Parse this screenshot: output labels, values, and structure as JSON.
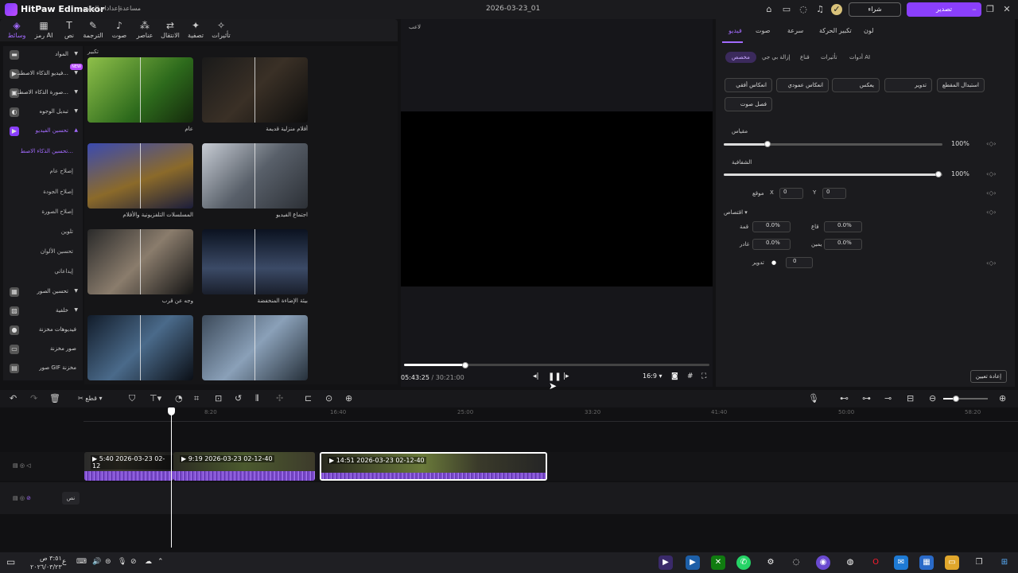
{
  "app": {
    "name": "HitPaw Edimakor",
    "project": "2026-03-23_01",
    "menu": [
      "مساعدة",
      "إعدادات",
      "الملف"
    ],
    "buy": "شراء",
    "export": "تصدير"
  },
  "media_tabs": [
    "وسائط",
    "رمز AI",
    "نص",
    "الترجمة",
    "صوت",
    "عناصر",
    "الانتقال",
    "تصفية",
    "تأثيرات"
  ],
  "left_nav": {
    "items": [
      "المواد",
      "فيديو الذكاء الاصطنـ...",
      "صورة الذكاء الاصطـ...",
      "تبديل الوجوه",
      "تحسين الفيديو"
    ],
    "new_badge": "NEW",
    "sub": [
      "تحسين الذكاء الاصط...",
      "إصلاح عام",
      "إصلاح الجودة",
      "إصلاح الصورة",
      "تلوين",
      "تحسين الألوان",
      "إيداعاتي"
    ],
    "items2": [
      "تحسين الصور",
      "خلفية",
      "فيديوهات مخزنة",
      "صور مخزنة",
      "صور GIF مخزنة"
    ]
  },
  "grid": {
    "heading": "تكبير",
    "captions": [
      "عام",
      "أفلام منزلية قديمة",
      "المسلسلات التلفزيونية والأفلام",
      "اجتماع الفيديو",
      "وجه عن قرب",
      "بيئة الإضاءة المنخفضة"
    ]
  },
  "player": {
    "label": "لاعب",
    "time_current": "05:43:25",
    "time_total": "/ 30:21:00",
    "ratio": "16:9",
    "progress": 0.2
  },
  "props": {
    "tabs": [
      "فيديو",
      "صوت",
      "سرعة",
      "تكبير الحركة",
      "لون"
    ],
    "subtabs": [
      "مخصص",
      "إزالة بي جي",
      "قناع",
      "تأثيرات",
      "أدوات AI"
    ],
    "buttons": [
      "استبدال المقطع",
      "تدوير",
      "يعكس",
      "انعكاس عمودي",
      "انعكاس أفقي",
      "فصل صوت"
    ],
    "scale_label": "مقياس",
    "scale_val": "100%",
    "opacity_label": "الشفافية",
    "opacity_val": "100%",
    "pos_label": "موقع",
    "x": "X",
    "x_val": "0",
    "y": "Y",
    "y_val": "0",
    "crop_label": "اقتصاص",
    "top": "قمة",
    "top_val": "0.0%",
    "bottom": "قاع",
    "bottom_val": "0.0%",
    "left": "غادر",
    "left_val": "0.0%",
    "right": "يمين",
    "right_val": "0.0%",
    "rotate_label": "تدوير",
    "rotate_val": "0",
    "reset": "إعادة تعيين"
  },
  "timeline": {
    "split_label": "قطع",
    "ruler": [
      "8:20",
      "16:40",
      "25:00",
      "33:20",
      "41:40",
      "50:00",
      "58:20"
    ],
    "clips": [
      "5:40 2026-03-23 02-12",
      "9:19 2026-03-23 02-12-40",
      "14:51 2026-03-23 02-12-40"
    ],
    "track2_label": "نص"
  },
  "taskbar": {
    "clock_time": "٣:٥١ ص",
    "clock_date": "٢٠٢٦/٠٣/٢٣",
    "lang": "ع"
  }
}
